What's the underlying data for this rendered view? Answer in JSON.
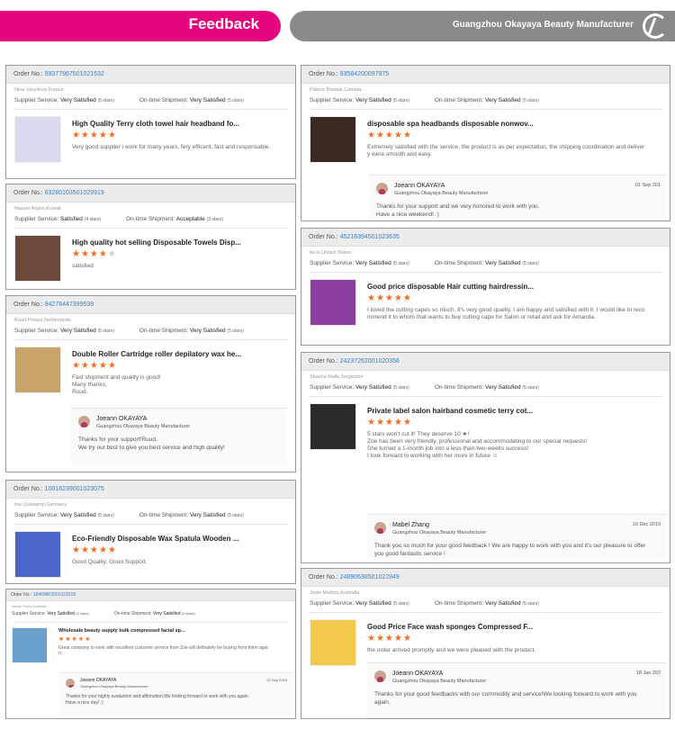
{
  "banner": {
    "title": "Feedback",
    "company": "Guangzhou Okayaya Beauty Manufacturer"
  },
  "labels": {
    "order_no": "Order No.:",
    "supplier_service": "Supplier Service:",
    "on_time": "On-time Shipment:"
  },
  "cards": [
    {
      "order": "59377967501021532",
      "buyer": "Nina Vasylieva,France",
      "supplier": "Very Satisfied",
      "supplier_stars": "(5 stars)",
      "shipment": "Very Satisfied",
      "shipment_stars": "(5 stars)",
      "title": "High Quality Terry cloth towel hair headband fo...",
      "stars": "★★★★★",
      "stars_off": "",
      "comment": "Very good supplier i work for many years, fery efficent, fast and responsable.",
      "thumb_color": "#d9d9ef"
    },
    {
      "order": "63280103501029919",
      "buyer": "Nasser Alajmi,Kuwait",
      "supplier": "Satisfied",
      "supplier_stars": "(4 stars)",
      "shipment": "Acceptable",
      "shipment_stars": "(3 stars)",
      "title": "High quality hot selling Disposable Towels Disp...",
      "stars": "★★★★",
      "stars_off": "★",
      "comment": "satisfied",
      "thumb_color": "#6b4a3c"
    },
    {
      "order": "94278447399539",
      "buyer": "Ruud Plones,Netherlands",
      "supplier": "Very Satisfied",
      "supplier_stars": "(5 stars)",
      "shipment": "Very Satisfied",
      "shipment_stars": "(5 stars)",
      "title": "Double Roller Cartridge roller depilatory wax he...",
      "stars": "★★★★★",
      "stars_off": "",
      "comment": "Fast shipment and quality is good!\nMany thanks,\nRuud.",
      "thumb_color": "#c9a46a",
      "reply": {
        "name": "Joeann OKAYAYA",
        "company": "Guangzhou Okayaya Beauty Manufacturer",
        "date": "",
        "text": "Thanks for your support!Ruud.\nWe try our best to give you best service and high quality!"
      }
    },
    {
      "order": "10016239001023075",
      "buyer": "Ina Quiskamp,Germany",
      "supplier": "Very Satisfied",
      "supplier_stars": "(5 stars)",
      "shipment": "Very Satisfied",
      "shipment_stars": "(5 stars)",
      "title": "Eco-Friendly Disposable Wax Spatula Wooden ...",
      "stars": "★★★★★",
      "stars_off": "",
      "comment": "Good Quality, Good Support.",
      "thumb_color": "#4b66c9"
    },
    {
      "order": "18469862001023018",
      "buyer": "Nicole Shirly,Australia",
      "supplier": "Very Satisfied",
      "supplier_stars": "(5 stars)",
      "shipment": "Very Satisfied",
      "shipment_stars": "(5 stars)",
      "title": "Wholesale beauty supply bulk compressed facial sp...",
      "stars": "★★★★★",
      "stars_off": "",
      "comment": "Great company to work with excellent customer service from Zoe will definately be buying from them agai\nn.",
      "thumb_color": "#6aa0c9",
      "reply": {
        "name": "Joeann OKAYAYA",
        "company": "Guangzhou Okayaya Beauty Manufacturer",
        "date": "22 Sep 2019",
        "text": "Thanks for your highly evaluation and affirmation.We looking forward to work with you again.\nHave a nice day! :)"
      }
    },
    {
      "order": "93584200097975",
      "buyer": "Patrice Boulais,Canada",
      "supplier": "Very Satisfied",
      "supplier_stars": "(5 stars)",
      "shipment": "Very Satisfied",
      "shipment_stars": "(5 stars)",
      "title": "disposable spa headbands disposable nonwov...",
      "stars": "★★★★★",
      "stars_off": "",
      "comment": "Extremely satisfied with the service, the product is as per expectation, the shipping coordination and deliver\ny were smooth and easy.",
      "thumb_color": "#3b2a22",
      "reply": {
        "name": "Joeann OKAYAYA",
        "company": "Guangzhou Okayaya Beauty Manufacturer",
        "date": "01 Sep 201",
        "text": "Thanks for your support and we very honored to work with you.\nHave a nice weekend! :)"
      }
    },
    {
      "order": "45216394501023635",
      "buyer": "tai le,United States",
      "supplier": "Very Satisfied",
      "supplier_stars": "(5 stars)",
      "shipment": "Very Satisfied",
      "shipment_stars": "(5 stars)",
      "title": "Good price disposable Hair cutting hairdressin...",
      "stars": "★★★★★",
      "stars_off": "",
      "comment": "I loved the cutting capes so much. It's very good quality, I am happy and satisfied with it. I would like to reco\nmmend it to whom that wants to buy cutting cape for Salon or retail and ask for Amanda.",
      "thumb_color": "#8a3fa0"
    },
    {
      "order": "24237262001020356",
      "buyer": "Shasha Malik,Singapore",
      "supplier": "Very Satisfied",
      "supplier_stars": "(5 stars)",
      "shipment": "Very Satisfied",
      "shipment_stars": "(5 stars)",
      "title": "Private label salon hairband cosmetic terry cot...",
      "stars": "★★★★★",
      "stars_off": "",
      "comment": "5 stars won't cut it! They deserve 10 ★!\nZoe has been very friendly, professional and accommodating to our special requests!\nShe turned a 1-month job into a less-than-two-weeks success!\nI look forward  to working with her more in future ☺",
      "thumb_color": "#2a2a2a",
      "reply": {
        "name": "Mabel Zhang",
        "company": "Guangzhou Okayaya Beauty Manufacturer",
        "date": "19 Dec 2019",
        "text": "Thank you so much for your good feedback ! We are happy to work with you and it's our pleasure to offer\nyou good fantastic service !"
      }
    },
    {
      "order": "24890638501022949",
      "buyer": "Jodie Mellors,Australia",
      "supplier": "Very Satisfied",
      "supplier_stars": "(5 stars)",
      "shipment": "Very Satisfied",
      "shipment_stars": "(5 stars)",
      "title": "Good Price Face wash sponges Compressed F...",
      "stars": "★★★★★",
      "stars_off": "",
      "comment": "the order arrived promptly and we were pleased with the product.",
      "thumb_color": "#f2c94c",
      "reply": {
        "name": "Joeann OKAYAYA",
        "company": "Guangzhou Okayaya Beauty Manufacturer",
        "date": "18 Jan 202",
        "text": "Thanks for your good feedbacks with our commodity and service!We looking forward to work with you\nagain."
      }
    }
  ]
}
